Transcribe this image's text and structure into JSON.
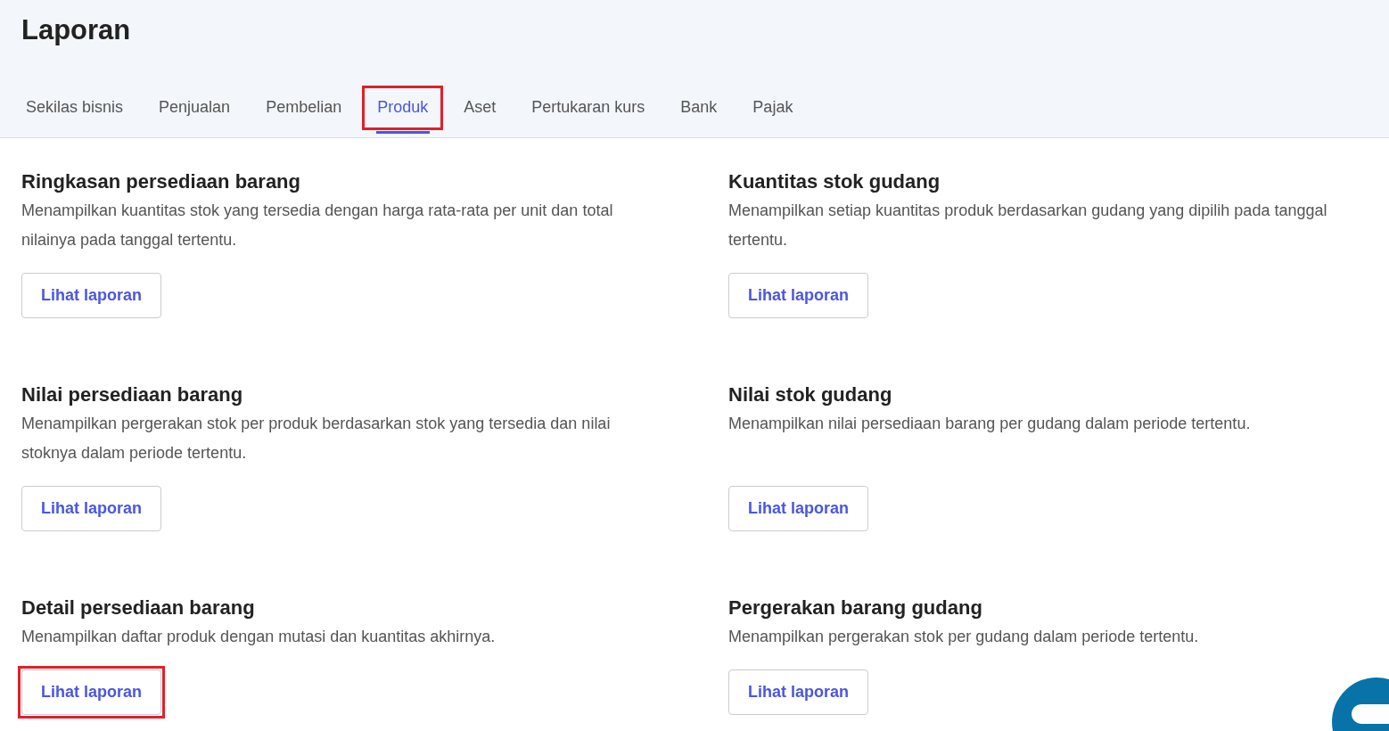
{
  "page": {
    "title": "Laporan"
  },
  "tabs": [
    {
      "label": "Sekilas bisnis",
      "selected": false,
      "highlighted": false
    },
    {
      "label": "Penjualan",
      "selected": false,
      "highlighted": false
    },
    {
      "label": "Pembelian",
      "selected": false,
      "highlighted": false
    },
    {
      "label": "Produk",
      "selected": true,
      "highlighted": true
    },
    {
      "label": "Aset",
      "selected": false,
      "highlighted": false
    },
    {
      "label": "Pertukaran kurs",
      "selected": false,
      "highlighted": false
    },
    {
      "label": "Bank",
      "selected": false,
      "highlighted": false
    },
    {
      "label": "Pajak",
      "selected": false,
      "highlighted": false
    }
  ],
  "reports": [
    {
      "title": "Ringkasan persediaan barang",
      "description": "Menampilkan kuantitas stok yang tersedia dengan harga rata-rata per unit dan total nilainya pada tanggal tertentu.",
      "button": "Lihat laporan",
      "highlighted": false
    },
    {
      "title": "Kuantitas stok gudang",
      "description": "Menampilkan setiap kuantitas produk berdasarkan gudang yang dipilih pada tanggal tertentu.",
      "button": "Lihat laporan",
      "highlighted": false
    },
    {
      "title": "Nilai persediaan barang",
      "description": "Menampilkan pergerakan stok per produk berdasarkan stok yang tersedia dan nilai stoknya dalam periode tertentu.",
      "button": "Lihat laporan",
      "highlighted": false
    },
    {
      "title": "Nilai stok gudang",
      "description": "Menampilkan nilai persediaan barang per gudang dalam periode tertentu.",
      "button": "Lihat laporan",
      "highlighted": false
    },
    {
      "title": "Detail persediaan barang",
      "description": "Menampilkan daftar produk dengan mutasi dan kuantitas akhirnya.",
      "button": "Lihat laporan",
      "highlighted": true
    },
    {
      "title": "Pergerakan barang gudang",
      "description": "Menampilkan pergerakan stok per gudang dalam periode tertentu.",
      "button": "Lihat laporan",
      "highlighted": false
    }
  ]
}
